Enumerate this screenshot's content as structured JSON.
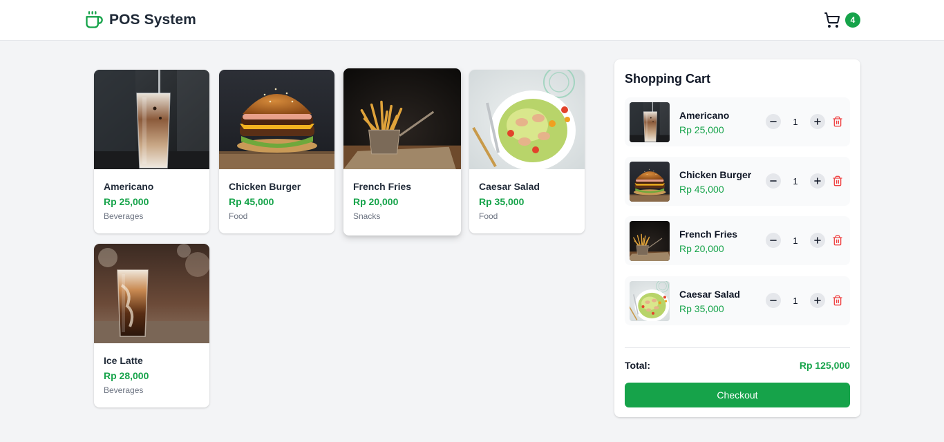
{
  "header": {
    "title": "POS System",
    "cart_count": "4",
    "brand_color": "#16a34a"
  },
  "products": [
    {
      "name": "Americano",
      "price": "Rp 25,000",
      "category": "Beverages",
      "image": "iced-coffee-photo"
    },
    {
      "name": "Chicken Burger",
      "price": "Rp 45,000",
      "category": "Food",
      "image": "burger-photo"
    },
    {
      "name": "French Fries",
      "price": "Rp 20,000",
      "category": "Snacks",
      "image": "fries-photo"
    },
    {
      "name": "Caesar Salad",
      "price": "Rp 35,000",
      "category": "Food",
      "image": "salad-photo"
    },
    {
      "name": "Ice Latte",
      "price": "Rp 28,000",
      "category": "Beverages",
      "image": "iced-latte-photo"
    }
  ],
  "cart": {
    "title": "Shopping Cart",
    "items": [
      {
        "name": "Americano",
        "price": "Rp 25,000",
        "qty": "1"
      },
      {
        "name": "Chicken Burger",
        "price": "Rp 45,000",
        "qty": "1"
      },
      {
        "name": "French Fries",
        "price": "Rp 20,000",
        "qty": "1"
      },
      {
        "name": "Caesar Salad",
        "price": "Rp 35,000",
        "qty": "1"
      }
    ],
    "total_label": "Total:",
    "total_value": "Rp 125,000",
    "checkout_label": "Checkout",
    "icons": {
      "decrease": "minus-icon",
      "increase": "plus-icon",
      "remove": "trash-icon"
    }
  }
}
